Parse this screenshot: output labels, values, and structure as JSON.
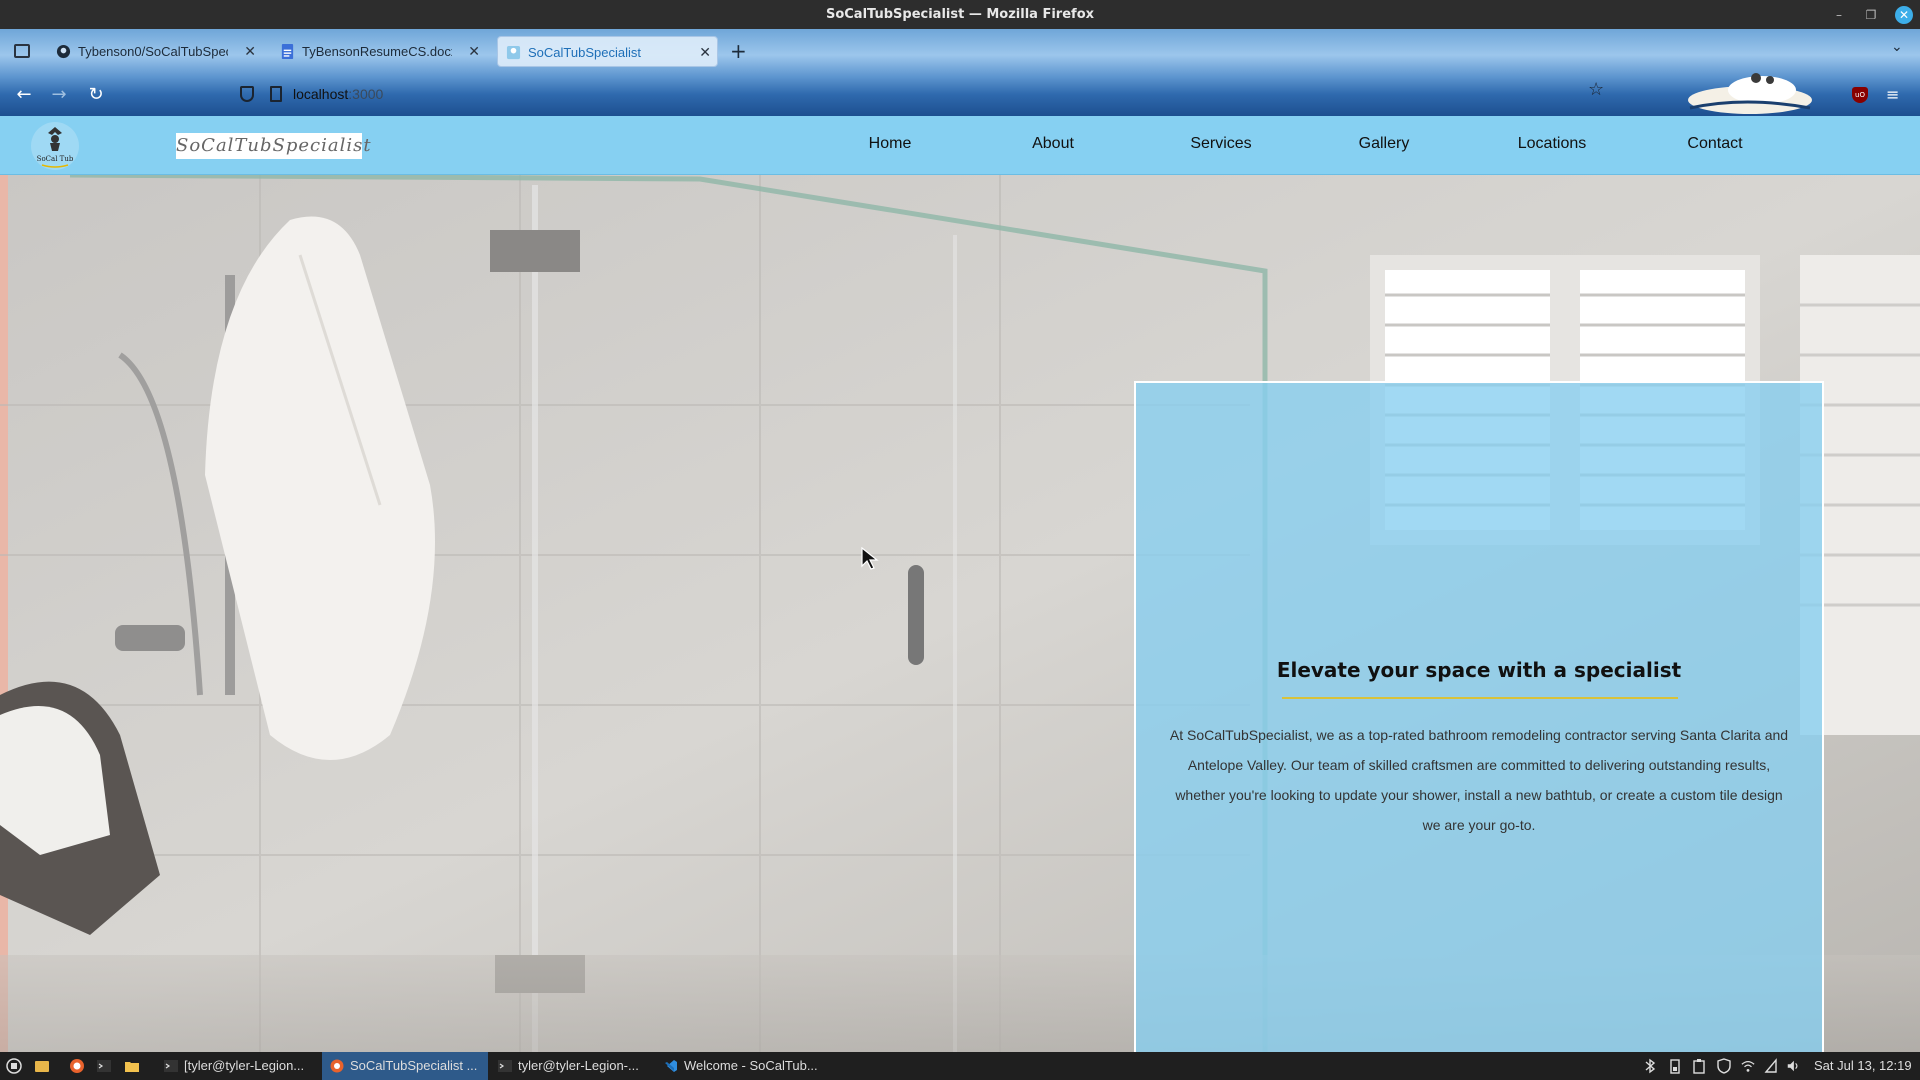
{
  "window": {
    "title": "SoCalTubSpecialist — Mozilla Firefox"
  },
  "browser": {
    "tabs": [
      {
        "label": "Tybenson0/SoCalTubSpecialist",
        "icon": "github-icon"
      },
      {
        "label": "TyBensonResumeCS.docx - Google Docs",
        "icon": "google-docs-icon"
      },
      {
        "label": "SoCalTubSpecialist",
        "icon": "site-favicon",
        "active": true
      }
    ],
    "url_host": "localhost",
    "url_port": ":3000"
  },
  "site": {
    "logo_text": "SoCalTubSpecialist",
    "logo_badge": "SoCal Tub",
    "nav": [
      "Home",
      "About",
      "Services",
      "Gallery",
      "Locations",
      "Contact"
    ],
    "hero": {
      "heading": "Elevate your space with a specialist",
      "body": "At SoCalTubSpecialist, we as a top-rated bathroom remodeling contractor serving Santa Clarita and Antelope Valley. Our team of skilled craftsmen are committed to delivering outstanding results, whether you're looking to update your shower, install a new bathtub, or create a custom tile design we are your go-to."
    },
    "colors": {
      "nav_bg": "#86d0f2",
      "panel_bg": "#87cef0",
      "accent_rule": "#d8c23a"
    }
  },
  "taskbar": {
    "tasks": [
      {
        "label": "[tyler@tyler-Legion...",
        "icon": "terminal-icon"
      },
      {
        "label": "SoCalTubSpecialist ...",
        "icon": "firefox-icon",
        "active": true
      },
      {
        "label": "tyler@tyler-Legion-...",
        "icon": "terminal-icon"
      },
      {
        "label": "Welcome - SoCalTub...",
        "icon": "vscode-icon"
      }
    ],
    "clock": "Sat Jul 13, 12:19"
  }
}
